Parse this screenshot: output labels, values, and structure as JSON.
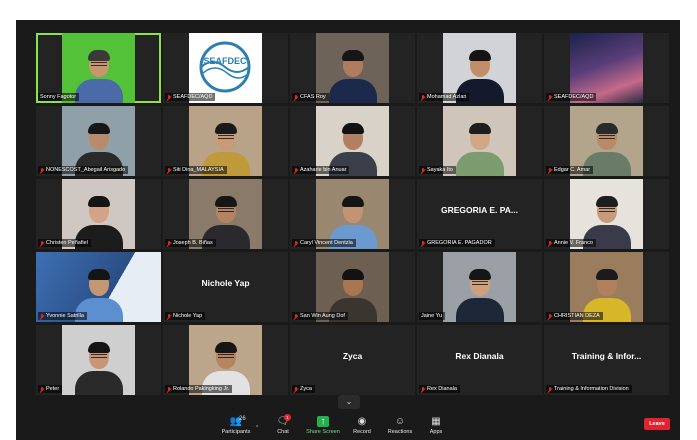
{
  "participants": [
    {
      "name": "Sonny Fagotor",
      "muted": false,
      "active": true,
      "bg": "#54c238",
      "skin": "#c89472",
      "hair": "#3a3a3a",
      "shirt": "#4a6aa8",
      "glasses": true
    },
    {
      "name": "SEAFDEC/AQD",
      "muted": true,
      "logo": "SEAFDEC",
      "bg": "#ffffff"
    },
    {
      "name": "CFAS Roy",
      "muted": true,
      "bg": "#6e6358",
      "skin": "#b07c5e",
      "hair": "#161616",
      "shirt": "#1b2a4c"
    },
    {
      "name": "Mohamad Azlan",
      "muted": true,
      "bg": "#d2d3d6",
      "skin": "#c28e6a",
      "hair": "#141414",
      "shirt": "#141a2c"
    },
    {
      "name": "SEAFDEC/AQD",
      "muted": true,
      "scene": "sky",
      "bg": "#3a2a58"
    },
    {
      "name": "NONESCOST_Abegail Arisgado",
      "muted": true,
      "bg": "#8fa0a8",
      "skin": "#b78b6c",
      "hair": "#171717",
      "shirt": "#2a2a2a"
    },
    {
      "name": "Siti Dina_MALAYSIA",
      "muted": true,
      "bg": "#b8a288",
      "skin": "#c9997a",
      "hair": "#1a1a1a",
      "shirt": "#c09a3a",
      "glasses": true
    },
    {
      "name": "Azaharie bin Anuar",
      "muted": true,
      "bg": "#d8d2c8",
      "skin": "#b28060",
      "hair": "#121212",
      "shirt": "#3a3f4a"
    },
    {
      "name": "Sayaka Ito",
      "muted": true,
      "bg": "#cfc5b8",
      "skin": "#d1a686",
      "hair": "#1e1e1e",
      "shirt": "#7a9c6e"
    },
    {
      "name": "Edgar C. Amar",
      "muted": true,
      "bg": "#b3a58c",
      "skin": "#b88a68",
      "hair": "#2a2a2a",
      "shirt": "#6a7c68",
      "glasses": true
    },
    {
      "name": "Christen Peñafiel",
      "muted": true,
      "bg": "#cfc8c2",
      "skin": "#d2a384",
      "hair": "#151515",
      "shirt": "#1c1c1c"
    },
    {
      "name": "Joseph B. Biñas",
      "muted": true,
      "bg": "#8a7a6a",
      "skin": "#b48462",
      "hair": "#161616",
      "shirt": "#2a2a2e",
      "glasses": true
    },
    {
      "name": "Caryl Vincent Dentzla",
      "muted": true,
      "bg": "#9a8770",
      "skin": "#c29474",
      "hair": "#151515",
      "shirt": "#6a9ad0"
    },
    {
      "name": "GREGORIA E. PAGADOR",
      "muted": true,
      "label": "GREGORIA E. PA..."
    },
    {
      "name": "Annie V. Franco",
      "muted": true,
      "bg": "#e6e2dc",
      "skin": "#c79a7a",
      "hair": "#1d1d1d",
      "shirt": "#3a3a4a",
      "glasses": true
    },
    {
      "name": "Yvonnie Satrilla",
      "muted": true,
      "scene": "aqd",
      "bg": "#2a4f86",
      "skin": "#c59672",
      "hair": "#151515",
      "shirt": "#5b8fd0"
    },
    {
      "name": "Nichole Yap",
      "muted": true,
      "label": "Nichole Yap"
    },
    {
      "name": "San Win Aung Dof",
      "muted": true,
      "bg": "#6d5f52",
      "skin": "#a8764f",
      "hair": "#121212",
      "shirt": "#3b3530"
    },
    {
      "name": "Jaine Yu",
      "muted": false,
      "bg": "#9aa0a6",
      "skin": "#cfa07e",
      "hair": "#161616",
      "shirt": "#1d2738",
      "glasses": true
    },
    {
      "name": "CHRISTIAN DEZA",
      "muted": true,
      "bg": "#9a7d5c",
      "skin": "#b3805e",
      "hair": "#1b1b1b",
      "shirt": "#d8b62a"
    },
    {
      "name": "Peter",
      "muted": true,
      "bg": "#cfcfcf",
      "skin": "#c89676",
      "hair": "#141414",
      "shirt": "#2a2a2a",
      "glasses": true
    },
    {
      "name": "Rolando Pakingking Jr.",
      "muted": true,
      "bg": "#bba68c",
      "skin": "#b6845f",
      "hair": "#161616",
      "shirt": "#e2e2e2",
      "glasses": true
    },
    {
      "name": "Zyca",
      "muted": true,
      "label": "Zyca"
    },
    {
      "name": "Rex Dianala",
      "muted": true,
      "label": "Rex Dianala"
    },
    {
      "name": "Training & Information Division",
      "muted": true,
      "label": "Training & Infor..."
    }
  ],
  "toolbar": {
    "participants_count": "26",
    "participants_label": "Participants",
    "chat_label": "Chat",
    "chat_badge": "1",
    "share_label": "Share Screen",
    "record_label": "Record",
    "reactions_label": "Reactions",
    "apps_label": "Apps",
    "leave_label": "Leave"
  }
}
